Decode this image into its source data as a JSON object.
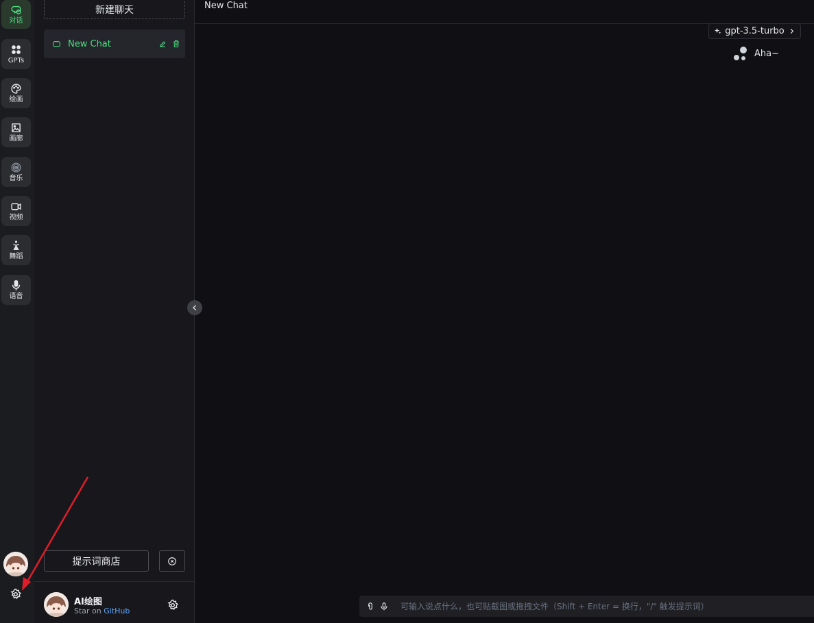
{
  "rail": {
    "items": [
      {
        "label": "对话",
        "icon": "chat-icon",
        "active": true
      },
      {
        "label": "GPTs",
        "icon": "grid-icon",
        "active": false
      },
      {
        "label": "绘画",
        "icon": "palette-icon",
        "active": false
      },
      {
        "label": "画廊",
        "icon": "image-icon",
        "active": false
      },
      {
        "label": "音乐",
        "icon": "music-icon",
        "active": false
      },
      {
        "label": "视频",
        "icon": "video-icon",
        "active": false
      },
      {
        "label": "舞蹈",
        "icon": "dance-icon",
        "active": false
      },
      {
        "label": "语音",
        "icon": "microphone-icon",
        "active": false
      }
    ]
  },
  "sidebar": {
    "new_chat_label": "新建聊天",
    "chat_items": [
      {
        "title": "New Chat"
      }
    ],
    "prompt_store_label": "提示词商店",
    "user": {
      "name": "AI绘图",
      "sub_prefix": "Star on",
      "sub_link": "GitHub"
    }
  },
  "header": {
    "title": "New Chat"
  },
  "model": {
    "name": "gpt-3.5-turbo"
  },
  "assistant": {
    "greeting": "Aha~"
  },
  "input": {
    "placeholder": "可输入说点什么，也可贴截图或拖拽文件（Shift + Enter = 换行，\"/\" 触发提示词）",
    "value": ""
  },
  "colors": {
    "accent": "#4ade80",
    "link": "#60a5fa",
    "annotation": "#e11d2a"
  }
}
